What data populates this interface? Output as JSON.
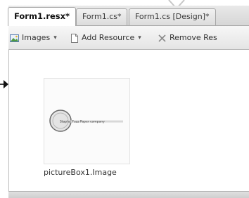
{
  "tabs": [
    {
      "label": "Form1.resx*",
      "active": true
    },
    {
      "label": "Form1.cs*",
      "active": false
    },
    {
      "label": "Form1.cs [Design]*",
      "active": false
    }
  ],
  "toolbar": {
    "images_label": "Images",
    "add_resource_label": "Add Resource",
    "remove_resource_label": "Remove Res",
    "dropdown_glyph": "▾"
  },
  "resource": {
    "name": "pictureBox1.Image",
    "logo_text": "Stapler Fuzz Paper company"
  }
}
